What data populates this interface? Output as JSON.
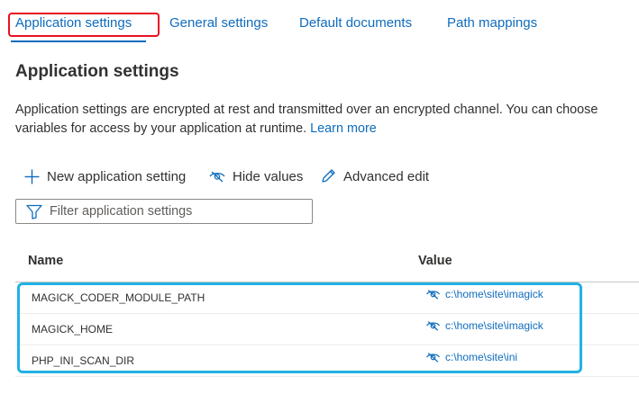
{
  "tabs": [
    {
      "label": "Application settings",
      "active": true
    },
    {
      "label": "General settings",
      "active": false
    },
    {
      "label": "Default documents",
      "active": false
    },
    {
      "label": "Path mappings",
      "active": false
    }
  ],
  "section": {
    "title": "Application settings",
    "description_line1": "Application settings are encrypted at rest and transmitted over an encrypted channel. You can choose",
    "description_line2": "variables for access by your application at runtime.",
    "learn_more": "Learn more"
  },
  "toolbar": {
    "new_label": "New application setting",
    "hide_label": "Hide values",
    "advanced_label": "Advanced edit"
  },
  "filter": {
    "placeholder": "Filter application settings",
    "value": ""
  },
  "table": {
    "columns": [
      "Name",
      "Value"
    ],
    "rows": [
      {
        "name": "MAGICK_CODER_MODULE_PATH",
        "value": "c:\\home\\site\\imagick"
      },
      {
        "name": "MAGICK_HOME",
        "value": "c:\\home\\site\\imagick"
      },
      {
        "name": "PHP_INI_SCAN_DIR",
        "value": "c:\\home\\site\\ini"
      }
    ]
  },
  "colors": {
    "accent": "#0f6cbd",
    "tab_highlight": "#e81123",
    "rows_highlight": "#21b1e4"
  },
  "icons": {
    "new": "plus-icon",
    "hide": "eye-hidden-icon",
    "advanced": "pencil-icon",
    "filter": "funnel-icon",
    "value": "eye-hidden-icon"
  }
}
